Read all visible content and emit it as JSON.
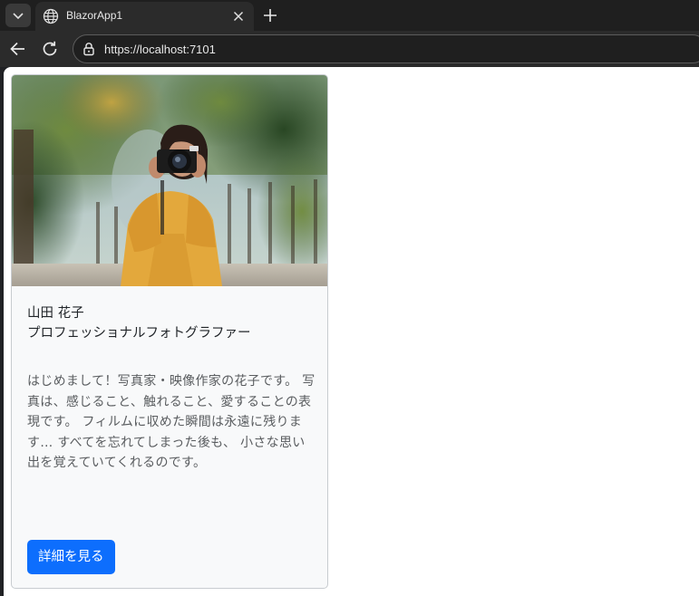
{
  "browser": {
    "tab": {
      "title": "BlazorApp1"
    },
    "address_bar": {
      "url": "https://localhost:7101"
    }
  },
  "card": {
    "image_alt": "photographer holding a camera",
    "name": "山田 花子",
    "subtitle": "プロフェッショナルフォトグラファー",
    "text": "はじめまして！写真家・映像作家の花子です。 写真は、感じること、触れること、愛することの表現です。 フィルムに収めた瞬間は永遠に残ります… すべてを忘れてしまった後も、 小さな思い出を覚えていてくれるのです。",
    "button_label": "詳細を見る"
  },
  "colors": {
    "accent": "#0d6efd",
    "card_background": "#f8f9fa",
    "browser_frame": "#2b2b2b"
  },
  "icons": {
    "tab_list": "chevron-down-icon",
    "favicon": "globe-icon",
    "tab_close": "close-icon",
    "new_tab": "plus-icon",
    "back": "arrow-left-icon",
    "reload": "reload-icon",
    "site_info": "site-info-icon"
  }
}
